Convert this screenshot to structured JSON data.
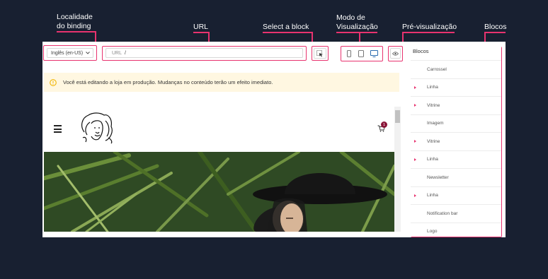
{
  "callouts": {
    "binding_locale": "Localidade\ndo binding",
    "url": "URL",
    "select_block": "Select a block",
    "view_mode": "Modo de\nVisualização",
    "preview": "Pré-visualização",
    "blocks": "Blocos"
  },
  "toolbar": {
    "locale_value": "Inglês (en-US)",
    "url_label": "URL",
    "url_value": "/",
    "select_block_icon": "cursor-select-icon",
    "devices": [
      "phone-icon",
      "tablet-icon",
      "desktop-icon"
    ],
    "preview_icon": "eye-icon"
  },
  "warning": {
    "text": "Você está editando a loja em produção. Mudanças no conteúdo terão um efeito imediato."
  },
  "store_preview": {
    "cart_count": "1"
  },
  "blocks_panel": {
    "title": "Blocos",
    "items": [
      {
        "label": "Carrossel",
        "expandable": false
      },
      {
        "label": "Linha",
        "expandable": true
      },
      {
        "label": "Vitrine",
        "expandable": true
      },
      {
        "label": "Imagem",
        "expandable": false
      },
      {
        "label": "Vitrine",
        "expandable": true
      },
      {
        "label": "Linha",
        "expandable": true
      },
      {
        "label": "Newsletter",
        "expandable": false
      },
      {
        "label": "Linha",
        "expandable": true
      },
      {
        "label": "Notification bar",
        "expandable": false
      },
      {
        "label": "Logo",
        "expandable": false
      }
    ]
  },
  "colors": {
    "background": "#182031",
    "highlight": "#e8336f",
    "warning_bg": "#fff7e1",
    "warning_icon": "#f0b400",
    "accent_blue": "#2b6cb0",
    "cart_badge": "#8a1538"
  }
}
